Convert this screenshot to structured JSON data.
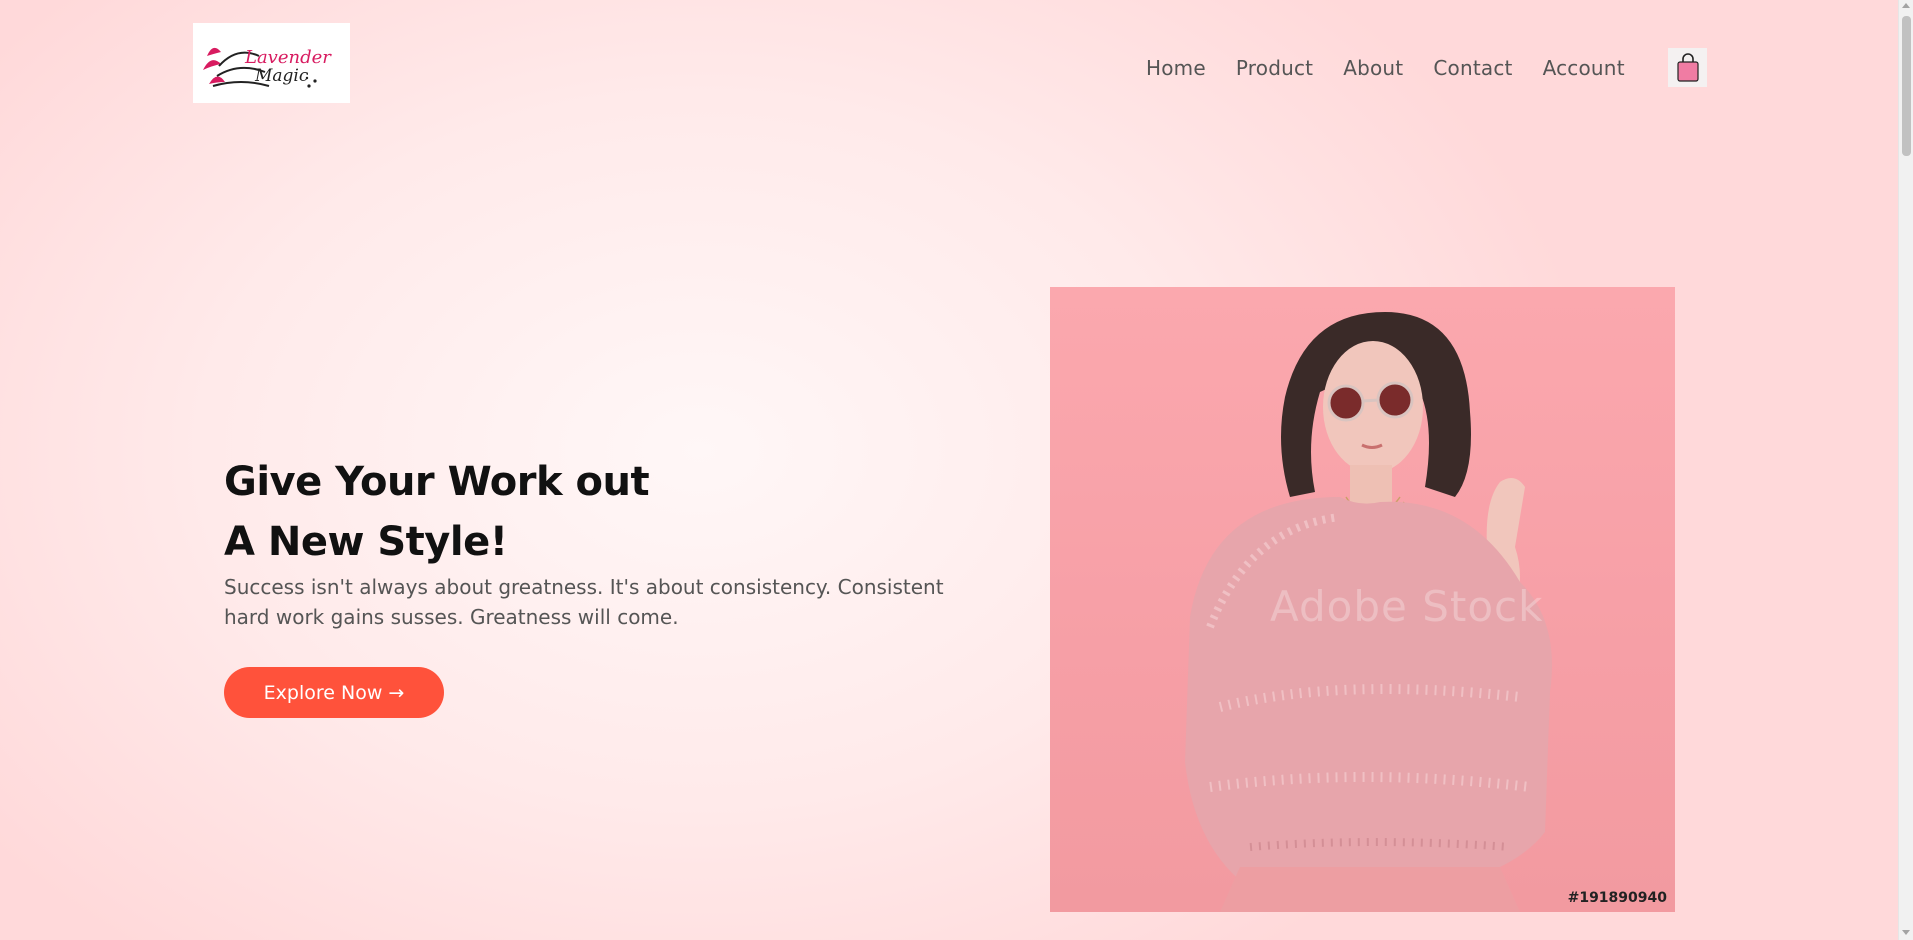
{
  "header": {
    "logo_text_line1": "Lavender",
    "logo_text_line2": "Magic",
    "nav": [
      {
        "label": "Home"
      },
      {
        "label": "Product"
      },
      {
        "label": "About"
      },
      {
        "label": "Contact"
      },
      {
        "label": "Account"
      }
    ],
    "cart_icon": "shopping-bag-icon"
  },
  "hero": {
    "title_line1": "Give Your Work out",
    "title_line2": "A New Style!",
    "subtitle": "Success isn't always about greatness. It's about consistency. Consistent hard work gains susses. Greatness will come.",
    "cta_label": "Explore Now →",
    "image_watermark": "Adobe Stock",
    "image_id": "#191890940"
  },
  "colors": {
    "accent": "#ff523b",
    "background": "#ffe4e4",
    "image_bg": "#f7a0a7",
    "cart_bag": "#f07ca3"
  }
}
